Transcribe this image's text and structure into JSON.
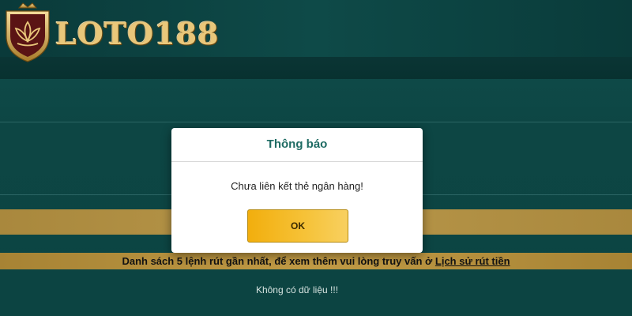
{
  "brand": {
    "name": "LOTO188"
  },
  "modal": {
    "title": "Thông báo",
    "message": "Chưa liên kết thẻ ngân hàng!",
    "ok_label": "OK"
  },
  "withdraw_history": {
    "notice_text": "Danh sách 5 lệnh rút gần nhất, để xem thêm vui lòng truy vấn ở ",
    "link_label": "Lịch sử rút tiền",
    "empty_text": "Không có dữ liệu !!!"
  },
  "colors": {
    "background": "#0d4a48",
    "gold": "#b8974a",
    "modal_title": "#1e6b63",
    "button": "#f2ae0d"
  }
}
